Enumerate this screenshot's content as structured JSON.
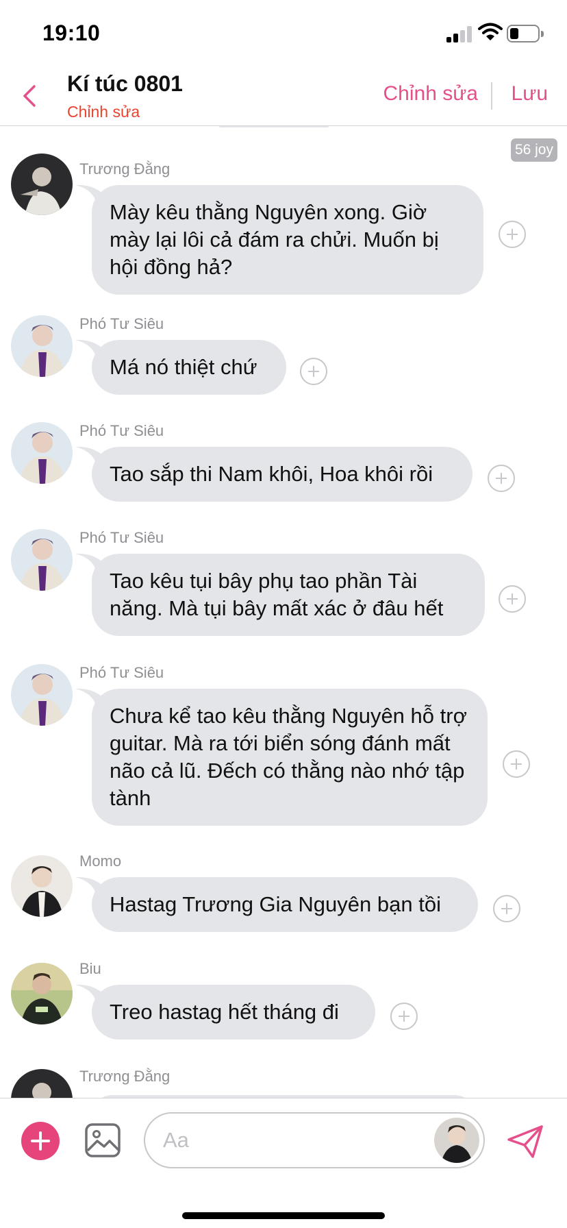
{
  "status_bar": {
    "time": "19:10"
  },
  "header": {
    "title": "Kí túc 0801",
    "subtitle": "Chỉnh sửa",
    "edit_label": "Chỉnh sửa",
    "save_label": "Lưu"
  },
  "badge": "56 joy",
  "messages": [
    {
      "sender": "Trương Đằng",
      "text": "Mày kêu thằng Nguyên xong. Giờ mày lại lôi cả đám ra chửi. Muốn bị hội đồng hả?"
    },
    {
      "sender": "Phó Tư Siêu",
      "text": "Má nó thiệt chứ"
    },
    {
      "sender": "Phó Tư Siêu",
      "text": "Tao sắp thi Nam khôi, Hoa khôi rồi"
    },
    {
      "sender": "Phó Tư Siêu",
      "text": "Tao kêu tụi bây phụ tao phần Tài năng. Mà tụi bây mất xác ở đâu hết"
    },
    {
      "sender": "Phó Tư Siêu",
      "text": "Chưa kể tao kêu thằng Nguyên hỗ trợ guitar. Mà ra tới biển sóng đánh mất não cả lũ. Đếch có thằng nào nhớ tập tành"
    },
    {
      "sender": "Momo",
      "text": "Hastag Trương Gia Nguyên bạn tồi"
    },
    {
      "sender": "Biu",
      "text": "Treo hastag hết tháng đi"
    },
    {
      "sender": "Trương Đằng",
      "text": ""
    }
  ],
  "composer": {
    "placeholder": "Aa"
  },
  "colors": {
    "accent": "#e5508a",
    "subtitle": "#e8432e",
    "bubble": "#e4e5e8"
  }
}
